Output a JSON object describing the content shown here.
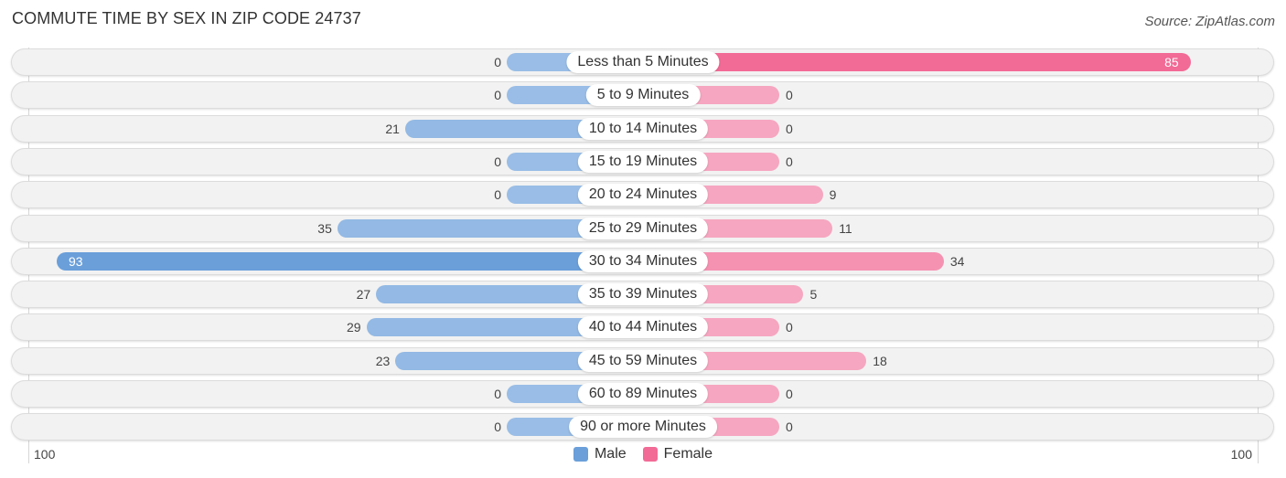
{
  "chart_data": {
    "type": "bar",
    "orientation": "horizontal-diverging",
    "title": "COMMUTE TIME BY SEX IN ZIP CODE 24737",
    "source": "Source: ZipAtlas.com",
    "categories": [
      "Less than 5 Minutes",
      "5 to 9 Minutes",
      "10 to 14 Minutes",
      "15 to 19 Minutes",
      "20 to 24 Minutes",
      "25 to 29 Minutes",
      "30 to 34 Minutes",
      "35 to 39 Minutes",
      "40 to 44 Minutes",
      "45 to 59 Minutes",
      "60 to 89 Minutes",
      "90 or more Minutes"
    ],
    "series": [
      {
        "name": "Male",
        "color": "#6a9fda",
        "light_color": "#99bde6",
        "values": [
          0,
          0,
          21,
          0,
          0,
          35,
          93,
          27,
          29,
          23,
          0,
          0
        ]
      },
      {
        "name": "Female",
        "color": "#f26a96",
        "light_color": "#f6a6c0",
        "values": [
          85,
          0,
          0,
          0,
          9,
          11,
          34,
          5,
          0,
          18,
          0,
          0
        ]
      }
    ],
    "axis": {
      "left_label": "100",
      "right_label": "100",
      "max": 100
    },
    "legend": {
      "position": "bottom-center",
      "items": [
        "Male",
        "Female"
      ]
    }
  }
}
